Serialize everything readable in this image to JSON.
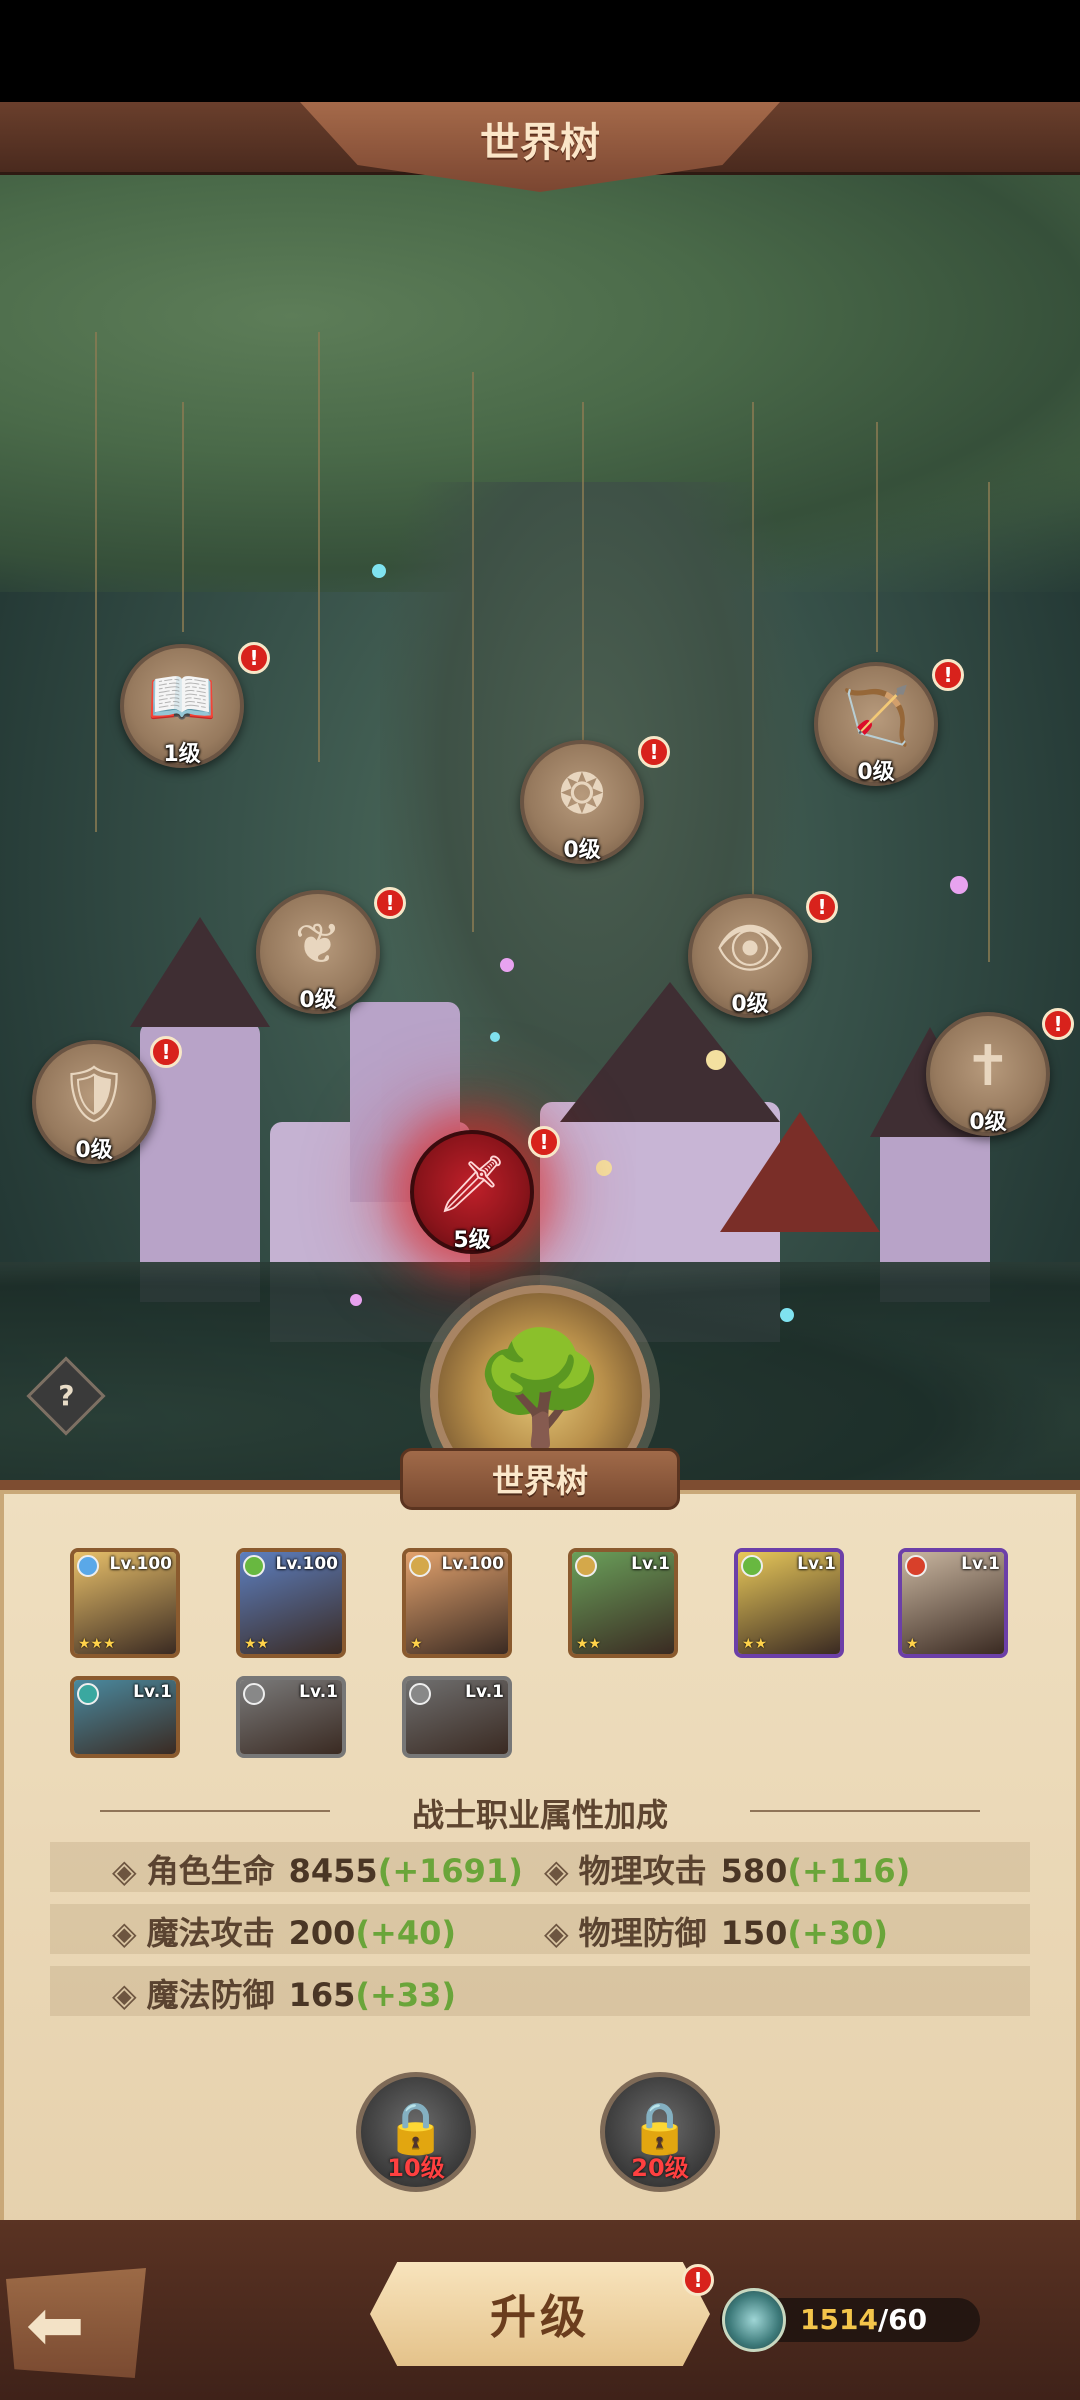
{
  "header": {
    "title": "世界树"
  },
  "nodes": [
    {
      "id": "book",
      "icon": "book-flame-icon",
      "glyph": "📖",
      "level": "1级",
      "alert": "!"
    },
    {
      "id": "spirit",
      "icon": "spirit-icon",
      "glyph": "❦",
      "level": "0级",
      "alert": "!"
    },
    {
      "id": "bow",
      "icon": "bow-icon",
      "glyph": "🏹",
      "level": "0级",
      "alert": "!"
    },
    {
      "id": "demon",
      "icon": "demon-mask-icon",
      "glyph": "❂",
      "level": "0级",
      "alert": "!"
    },
    {
      "id": "eye",
      "icon": "eye-emblem-icon",
      "glyph": "👁",
      "level": "0级",
      "alert": "!"
    },
    {
      "id": "shield",
      "icon": "shield-icon",
      "glyph": "🛡",
      "level": "0级",
      "alert": "!"
    },
    {
      "id": "sword",
      "icon": "sword-cross-icon",
      "glyph": "✝",
      "level": "0级",
      "alert": "!"
    },
    {
      "id": "warrior",
      "icon": "warrior-sword-icon",
      "glyph": "🗡",
      "level": "5级",
      "alert": "!"
    }
  ],
  "emblem": {
    "icon": "world-tree-icon",
    "glyph": "🌳",
    "label": "世界树"
  },
  "heroes": [
    {
      "level": "Lv.100",
      "stars": "★★★",
      "elem": "#5aa8e8",
      "art": "#e8c06a",
      "frame": "#8a5a2e"
    },
    {
      "level": "Lv.100",
      "stars": "★★",
      "elem": "#68b840",
      "art": "#5d7fc0",
      "frame": "#8a5a2e"
    },
    {
      "level": "Lv.100",
      "stars": "★",
      "elem": "#d4a84a",
      "art": "#e3a36e",
      "frame": "#8a5a2e"
    },
    {
      "level": "Lv.1",
      "stars": "★★",
      "elem": "#d4a84a",
      "art": "#6aa05a",
      "frame": "#8a5a2e"
    },
    {
      "level": "Lv.1",
      "stars": "★★",
      "elem": "#68b840",
      "art": "#e8c85a",
      "frame": "#6c3fa8"
    },
    {
      "level": "Lv.1",
      "stars": "★",
      "elem": "#d8402a",
      "art": "#c9b6a0",
      "frame": "#6c3fa8"
    },
    {
      "level": "Lv.1",
      "stars": "",
      "elem": "#3aa8a0",
      "art": "#4a8aa0",
      "frame": "#8a5a2e"
    },
    {
      "level": "Lv.1",
      "stars": "",
      "elem": "#888888",
      "art": "#7a7a7a",
      "frame": "#777777"
    },
    {
      "level": "Lv.1",
      "stars": "",
      "elem": "#888888",
      "art": "#6f6f6f",
      "frame": "#777777"
    }
  ],
  "bonus": {
    "title": "战士职业属性加成",
    "stats": [
      {
        "name": "角色生命",
        "value": "8455",
        "bonus": "(+1691)"
      },
      {
        "name": "物理攻击",
        "value": "580",
        "bonus": "(+116)"
      },
      {
        "name": "魔法攻击",
        "value": "200",
        "bonus": "(+40)"
      },
      {
        "name": "物理防御",
        "value": "150",
        "bonus": "(+30)"
      },
      {
        "name": "魔法防御",
        "value": "165",
        "bonus": "(+33)"
      }
    ]
  },
  "locks": [
    {
      "icon": "padlock-icon",
      "glyph": "🔒",
      "requirement": "10级"
    },
    {
      "icon": "padlock-icon",
      "glyph": "🔒",
      "requirement": "20级"
    }
  ],
  "footer": {
    "back_glyph": "⬅",
    "upgrade_label": "升级",
    "upgrade_alert": "!",
    "currency_have": "1514",
    "currency_need": "/60"
  },
  "help": {
    "glyph": "?"
  },
  "colors": {
    "accent_red": "#d8221c",
    "bonus_green": "#6aa53a",
    "panel": "#efdfc0",
    "frame_brown": "#7e4d31"
  }
}
